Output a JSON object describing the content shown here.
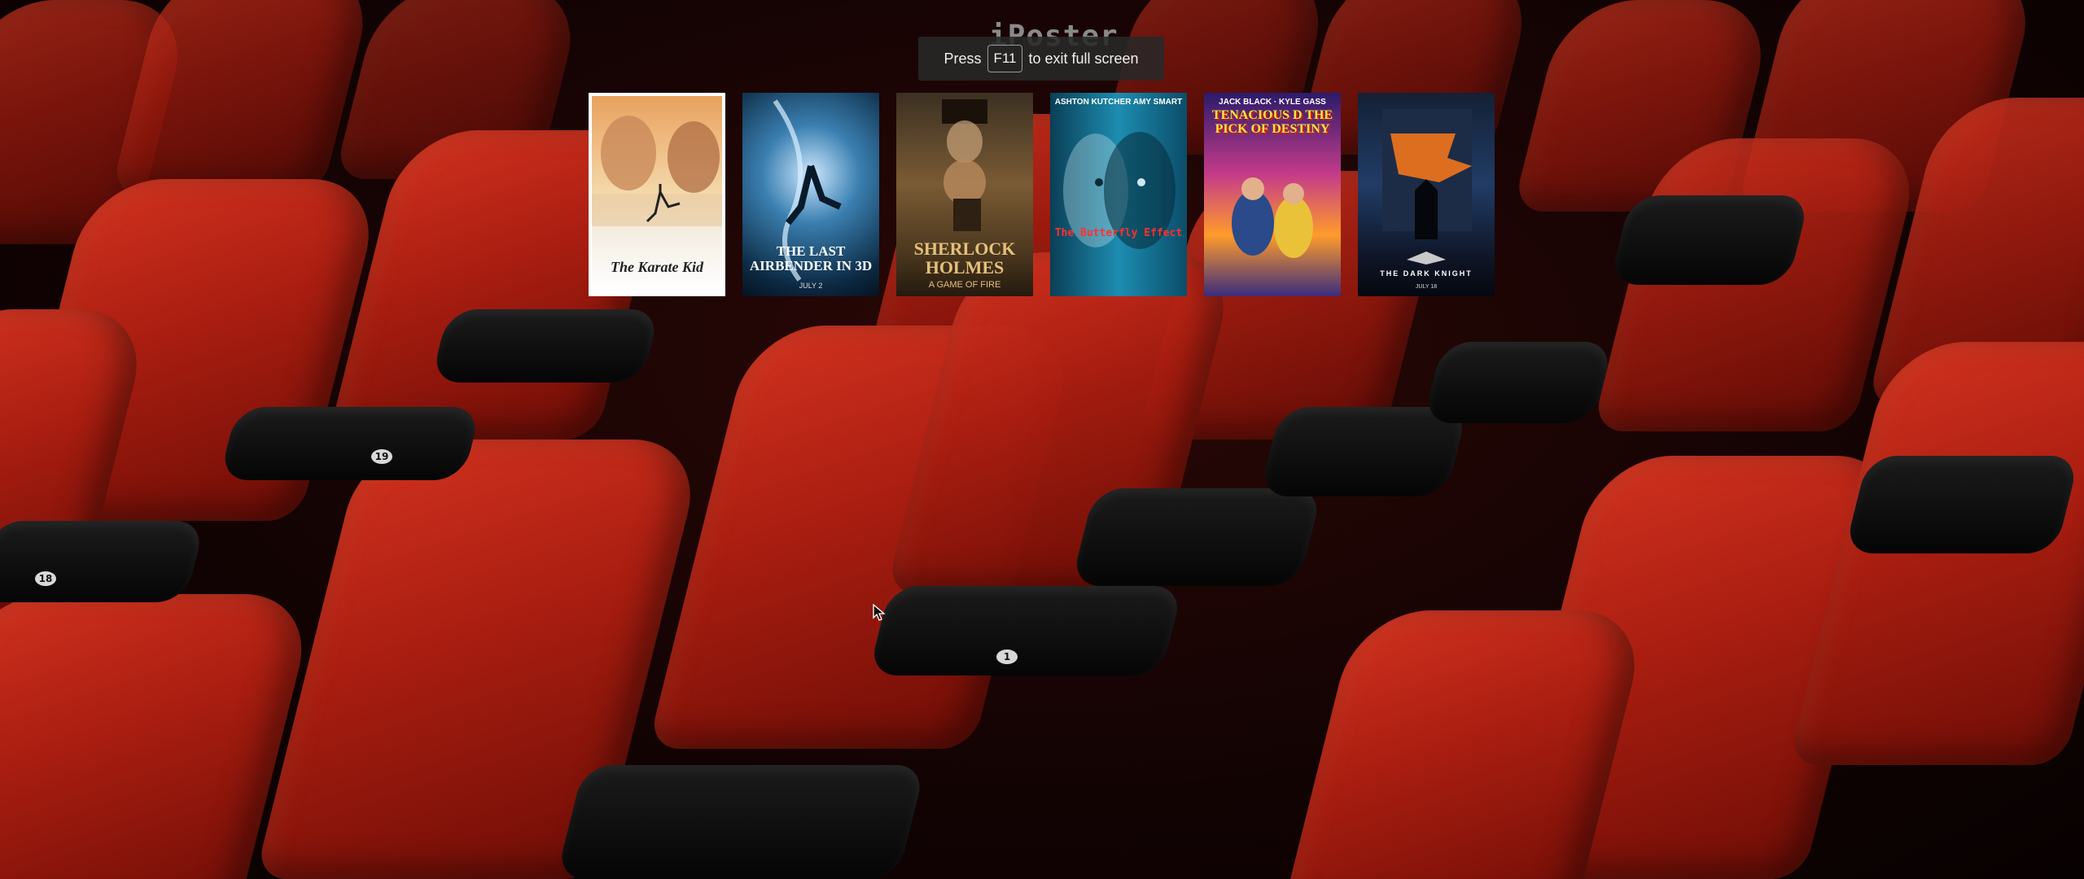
{
  "app": {
    "title": "iPoster"
  },
  "fullscreen_notice": {
    "prefix": "Press",
    "key": "F11",
    "suffix": "to exit full screen"
  },
  "posters": [
    {
      "title": "The Karate Kid",
      "tagline": "",
      "subtitle": "",
      "selected": true
    },
    {
      "title": "THE LAST AIRBENDER IN 3D",
      "tagline": "",
      "subtitle": "JULY 2",
      "selected": false
    },
    {
      "title": "SHERLOCK HOLMES",
      "tagline": "",
      "subtitle": "A GAME OF FIRE",
      "selected": false
    },
    {
      "title": "The Butterfly Effect",
      "tagline": "ASHTON KUTCHER   AMY SMART",
      "subtitle": "",
      "selected": false
    },
    {
      "title": "TENACIOUS D THE PICK OF DESTINY",
      "tagline": "JACK BLACK · KYLE GASS",
      "subtitle": "",
      "selected": false
    },
    {
      "title": "THE DARK KNIGHT",
      "tagline": "",
      "subtitle": "JULY 18",
      "selected": false
    }
  ],
  "seat_numbers": [
    "19",
    "18",
    "1"
  ]
}
